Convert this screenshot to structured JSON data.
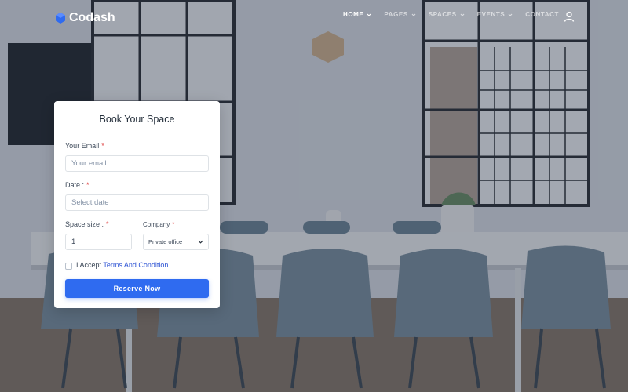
{
  "brand": {
    "name": "Codash",
    "accent": "#2f6bf0",
    "logo_icon": "hexagon-logo-icon"
  },
  "nav": {
    "items": [
      {
        "label": "HOME",
        "has_dropdown": true,
        "active": true
      },
      {
        "label": "PAGES",
        "has_dropdown": true,
        "active": false
      },
      {
        "label": "SPACES",
        "has_dropdown": true,
        "active": false
      },
      {
        "label": "EVENTS",
        "has_dropdown": true,
        "active": false
      },
      {
        "label": "CONTACT",
        "has_dropdown": false,
        "active": false
      }
    ],
    "user_icon": "user-icon"
  },
  "booking": {
    "title": "Book Your Space",
    "email": {
      "label": "Your Email",
      "required_mark": "*",
      "placeholder": "Your email :",
      "value": ""
    },
    "date": {
      "label": "Date :",
      "required_mark": "*",
      "placeholder": "Select date",
      "value": ""
    },
    "space_size": {
      "label": "Space size :",
      "required_mark": "*",
      "value": "1"
    },
    "company": {
      "label": "Company",
      "required_mark": "*",
      "selected": "Private office"
    },
    "terms": {
      "prefix": "I Accept",
      "link": "Terms And Condition",
      "checked": false
    },
    "submit_label": "Reserve Now"
  }
}
